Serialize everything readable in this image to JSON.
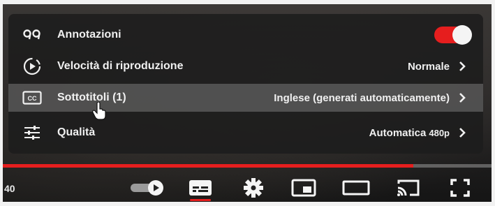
{
  "settings_menu": {
    "items": [
      {
        "label": "Annotazioni",
        "icon": "annotations-icon",
        "toggle_on": true
      },
      {
        "label": "Velocità di riproduzione",
        "icon": "playback-speed-icon",
        "value": "Normale"
      },
      {
        "label": "Sottotitoli (1)",
        "icon": "subtitles-icon",
        "value": "Inglese (generati automaticamente)"
      },
      {
        "label": "Qualità",
        "icon": "quality-icon",
        "value": "Automatica",
        "value_suffix": "480p"
      }
    ]
  },
  "player": {
    "time": "40",
    "progress": 0.84,
    "accent_color": "#e61e1e",
    "controls": [
      "autoplay-toggle-icon",
      "subtitles-button-icon",
      "settings-gear-icon",
      "miniplayer-icon",
      "theater-mode-icon",
      "cast-icon",
      "fullscreen-icon"
    ]
  }
}
